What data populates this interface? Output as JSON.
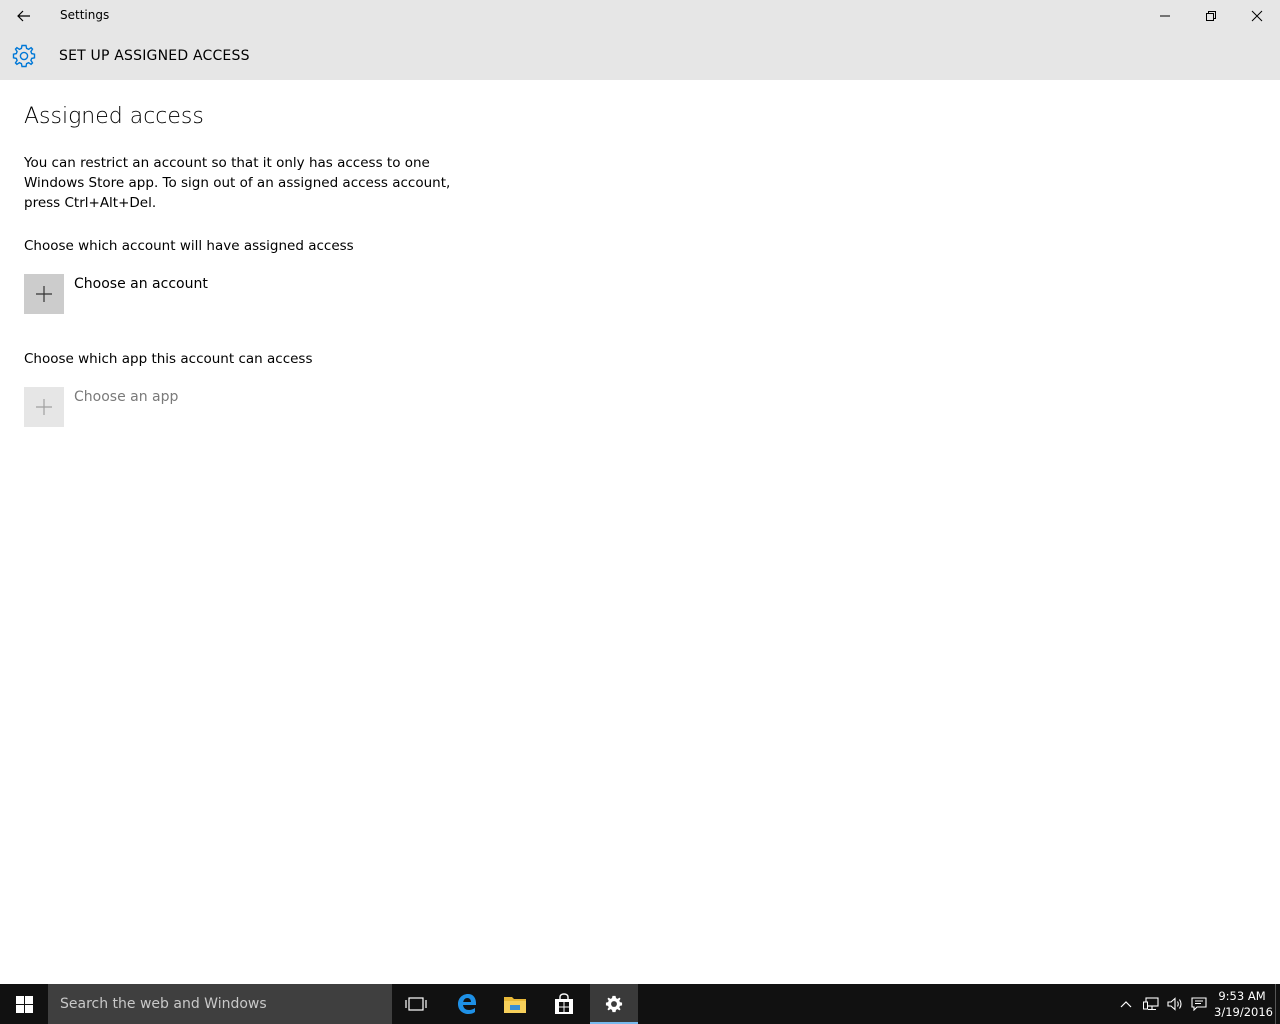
{
  "window": {
    "title": "Settings"
  },
  "header": {
    "title": "SET UP ASSIGNED ACCESS"
  },
  "content": {
    "heading": "Assigned access",
    "description": "You can restrict an account so that it only has access to one Windows Store app. To sign out of an assigned access account, press Ctrl+Alt+Del.",
    "account_section": {
      "label": "Choose which account will have assigned access",
      "button_label": "Choose an account"
    },
    "app_section": {
      "label": "Choose which app this account can access",
      "button_label": "Choose an app"
    }
  },
  "taskbar": {
    "search_placeholder": "Search the web and Windows",
    "clock_time": "9:53 AM",
    "clock_date": "3/19/2016"
  },
  "colors": {
    "accent": "#0078d7",
    "chrome": "#e6e6e6",
    "taskbar": "#111111",
    "disabled_text": "#7a7a7a"
  }
}
